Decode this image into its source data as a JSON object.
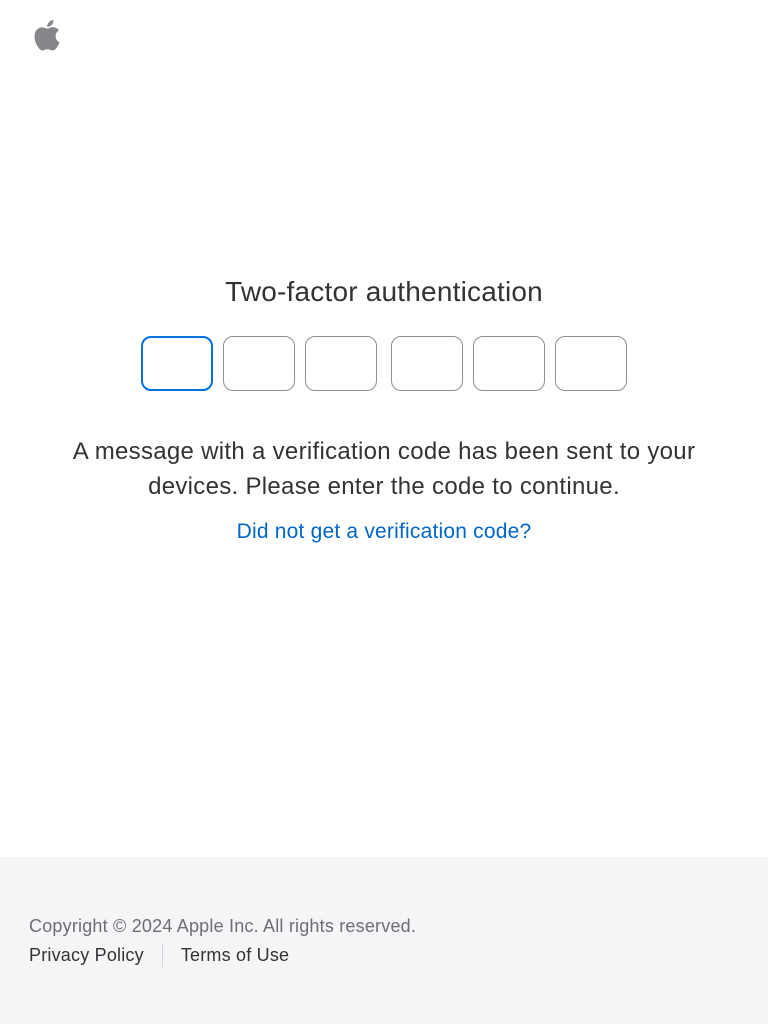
{
  "header": {
    "logo_icon": "apple-logo-icon"
  },
  "main": {
    "title": "Two-factor authentication",
    "code_boxes": [
      "",
      "",
      "",
      "",
      "",
      ""
    ],
    "message": "A message with a verification code has been sent to your devices. Please enter the code to continue.",
    "help_link": "Did not get a verification code?"
  },
  "footer": {
    "copyright": "Copyright © 2024 Apple Inc. All rights reserved.",
    "privacy_link": "Privacy Policy",
    "terms_link": "Terms of Use"
  },
  "colors": {
    "accent": "#0071e3",
    "link": "#0066cc",
    "text": "#333336",
    "footer_bg": "#f5f5f7",
    "logo": "#86868b"
  }
}
